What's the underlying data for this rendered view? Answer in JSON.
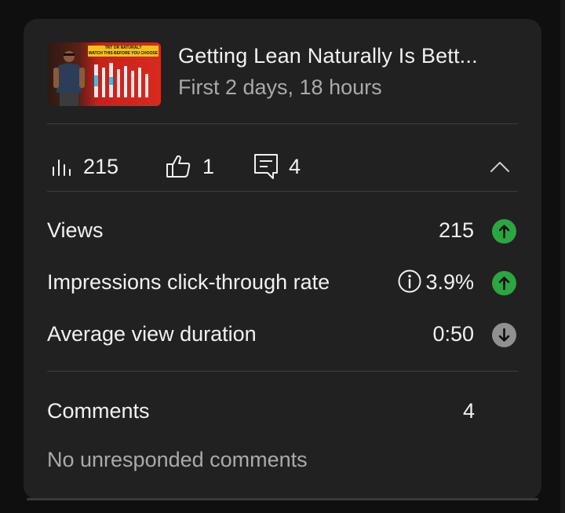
{
  "colors": {
    "card_bg": "#212121",
    "page_bg": "#0f0f0f",
    "trend_up": "#2ba640",
    "trend_down": "#909090",
    "secondary_text": "#aaaaaa"
  },
  "video": {
    "thumbnail_icon": "video-thumbnail",
    "thumbnail_banner_line1": "TRT OR NATURAL?",
    "thumbnail_banner_line2": "WATCH THIS BEFORE YOU CHOOSE",
    "title": "Getting Lean Naturally Is Bett...",
    "subtitle": "First 2 days, 18 hours"
  },
  "stats": {
    "views_icon": "bar-chart-icon",
    "views": "215",
    "likes_icon": "thumbs-up-icon",
    "likes": "1",
    "comments_icon": "comment-icon",
    "comments": "4",
    "collapse_icon": "chevron-up-icon"
  },
  "metrics": [
    {
      "label": "Views",
      "value": "215",
      "trend": "up",
      "trend_icon": "arrow-up-circle-icon"
    },
    {
      "label": "Impressions click-through rate",
      "value": "3.9%",
      "trend": "up",
      "trend_icon": "arrow-up-circle-icon",
      "info_icon": "info-icon"
    },
    {
      "label": "Average view duration",
      "value": "0:50",
      "trend": "down",
      "trend_icon": "arrow-down-circle-icon"
    }
  ],
  "comments_section": {
    "label": "Comments",
    "count": "4",
    "note": "No unresponded comments"
  }
}
